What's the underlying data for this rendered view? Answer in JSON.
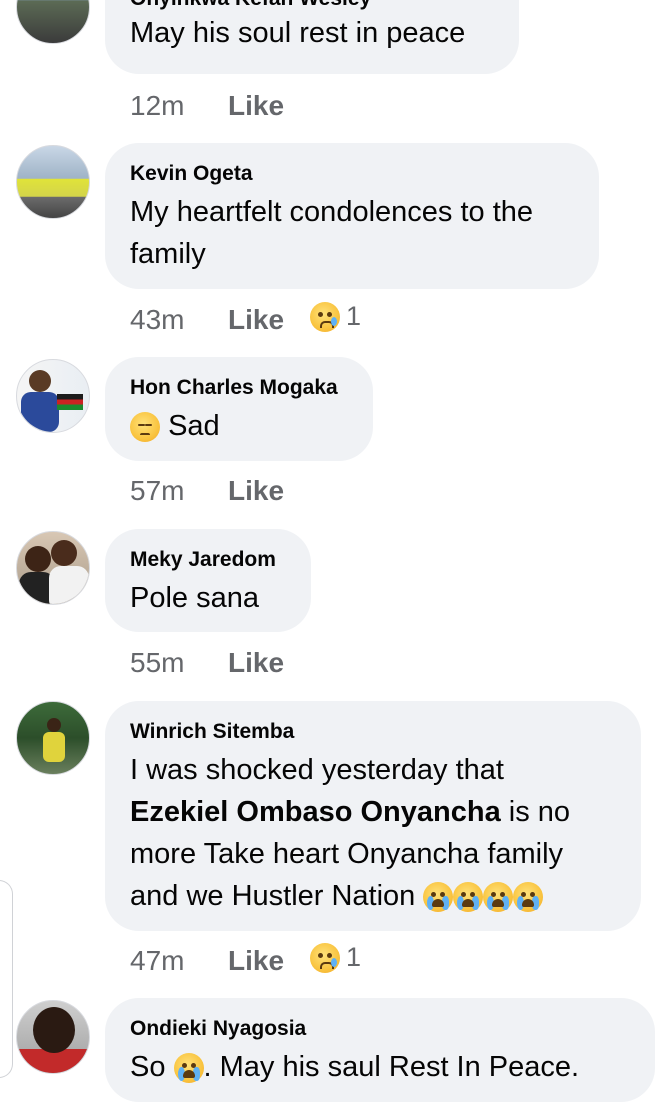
{
  "comments": [
    {
      "name": "Onyinkwa Kefah Wesley",
      "text": "May his soul rest in peace",
      "time": "12m",
      "like": "Like"
    },
    {
      "name": "Kevin Ogeta",
      "text_line1": "My heartfelt condolences to the",
      "text_line2": "family",
      "time": "43m",
      "like": "Like",
      "reaction_icon": "sad-crying-face-icon",
      "reaction_count": "1"
    },
    {
      "name": "Hon Charles Mogaka",
      "emoji": "pensive-face-icon",
      "text": "Sad",
      "time": "57m",
      "like": "Like"
    },
    {
      "name": "Meky Jaredom",
      "text": "Pole sana",
      "time": "55m",
      "like": "Like"
    },
    {
      "name": "Winrich Sitemba",
      "text_line1": "I was shocked yesterday that",
      "mention": "Ezekiel Ombaso Onyancha",
      "text_line2_rest": " is no",
      "text_line3": "more Take heart Onyancha family",
      "text_line4": "and we Hustler Nation",
      "emojis": [
        "loudly-crying-face-icon",
        "loudly-crying-face-icon",
        "loudly-crying-face-icon",
        "loudly-crying-face-icon"
      ],
      "time": "47m",
      "like": "Like",
      "reaction_icon": "sad-crying-face-icon",
      "reaction_count": "1"
    },
    {
      "name": "Ondieki Nyagosia",
      "text_before": "So ",
      "emoji": "loudly-crying-face-icon",
      "text_after": ". May his saul Rest In Peace."
    }
  ]
}
